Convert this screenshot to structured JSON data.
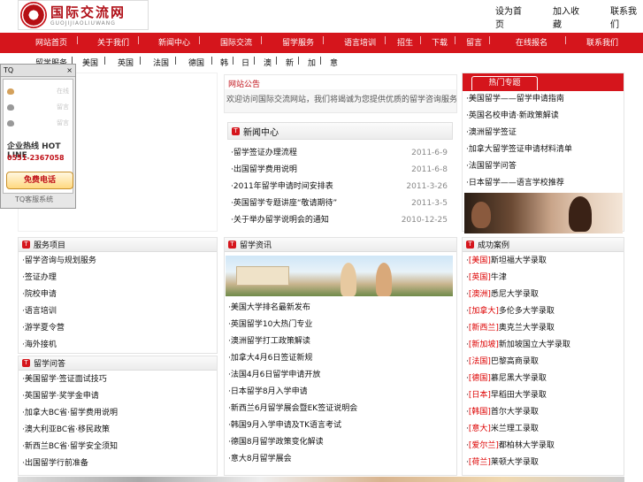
{
  "logo": {
    "title": "国际交流网",
    "subtitle": "GUOJIJIAOLIUWANG"
  },
  "toplinks": [
    "设为首页",
    "加入收藏",
    "联系我们"
  ],
  "nav": [
    "网站首页",
    "关于我们",
    "新闻中心",
    "国际交流",
    "留学服务",
    "语言培训",
    "招生",
    "下载",
    "留言",
    "在线报名",
    "联系我们"
  ],
  "subnav": [
    "留学服务",
    "美国",
    "英国",
    "法国",
    "德国",
    "韩",
    "日",
    "澳",
    "新",
    "加",
    "意"
  ],
  "announce": {
    "title": "网站公告",
    "text": "欢迎访问国际交流网站，我们将竭诚为您提供优质的留学咨询服务。"
  },
  "news": {
    "title": "新闻中心",
    "items": [
      {
        "text": "留学签证办理流程",
        "date": "2011-6-9"
      },
      {
        "text": "出国留学费用说明",
        "date": "2011-6-8"
      },
      {
        "text": "2011年留学申请时间安排表",
        "date": "2011-3-26"
      },
      {
        "text": "英国留学专题讲座“敬请期待”",
        "date": "2011-3-5"
      },
      {
        "text": "关于举办留学说明会的通知",
        "date": "2010-12-25"
      }
    ]
  },
  "right_top": {
    "title": "热门专题",
    "items": [
      "美国留学——留学申请指南",
      "英国名校申请·新政策解读",
      "澳洲留学签证",
      "加拿大留学签证申请材料清单",
      "法国留学问答",
      "日本留学——语言学校推荐"
    ]
  },
  "left_a": {
    "title": "服务项目",
    "items": [
      "留学咨询与规划服务",
      "签证办理",
      "院校申请",
      "语言培训",
      "游学夏令营",
      "海外接机"
    ]
  },
  "left_b": {
    "title": "留学问答",
    "items": [
      "美国留学·签证面试技巧",
      "英国留学·奖学金申请",
      "加拿大BC省·留学费用说明",
      "澳大利亚BC省·移民政策",
      "新西兰BC省·留学安全须知",
      "出国留学行前准备"
    ]
  },
  "mid": {
    "title": "留学资讯",
    "items": [
      "美国大学排名最新发布",
      "英国留学10大热门专业",
      "澳洲留学打工政策解读",
      "加拿大4月6日签证新规",
      "法国4月6日留学申请开放",
      "日本留学8月入学申请",
      "新西兰6月留学展会暨EK签证说明会",
      "韩国9月入学申请及TK语言考试",
      "德国8月留学政策变化解读",
      "意大8月留学展会"
    ]
  },
  "right_b": {
    "title": "成功案例",
    "items": [
      {
        "tag": "[美国]",
        "text": "斯坦福大学录取"
      },
      {
        "tag": "[英国]",
        "text": "牛津"
      },
      {
        "tag": "[澳洲]",
        "text": "悉尼大学录取"
      },
      {
        "tag": "[加拿大]",
        "text": "多伦多大学录取"
      },
      {
        "tag": "[新西兰]",
        "text": "奥克兰大学录取"
      },
      {
        "tag": "[新加坡]",
        "text": "新加坡国立大学录取"
      },
      {
        "tag": "[法国]",
        "text": "巴黎高商录取"
      },
      {
        "tag": "[德国]",
        "text": "慕尼黑大学录取"
      },
      {
        "tag": "[日本]",
        "text": "早稻田大学录取"
      },
      {
        "tag": "[韩国]",
        "text": "首尔大学录取"
      },
      {
        "tag": "[意大]",
        "text": "米兰理工录取"
      },
      {
        "tag": "[爱尔兰]",
        "text": "都柏林大学录取"
      },
      {
        "tag": "[荷兰]",
        "text": "莱顿大学录取"
      }
    ]
  },
  "tq": {
    "title": "TQ",
    "close": "×",
    "users": [
      "在线",
      "留言",
      "留言"
    ],
    "hot": "企业热线 HOT LINE",
    "tel": "0551-2367058",
    "free": "免费电话",
    "footer": "TQ客服系统"
  },
  "colors": {
    "nav_red": "#d5151c",
    "tag_red": "#dd0000"
  }
}
